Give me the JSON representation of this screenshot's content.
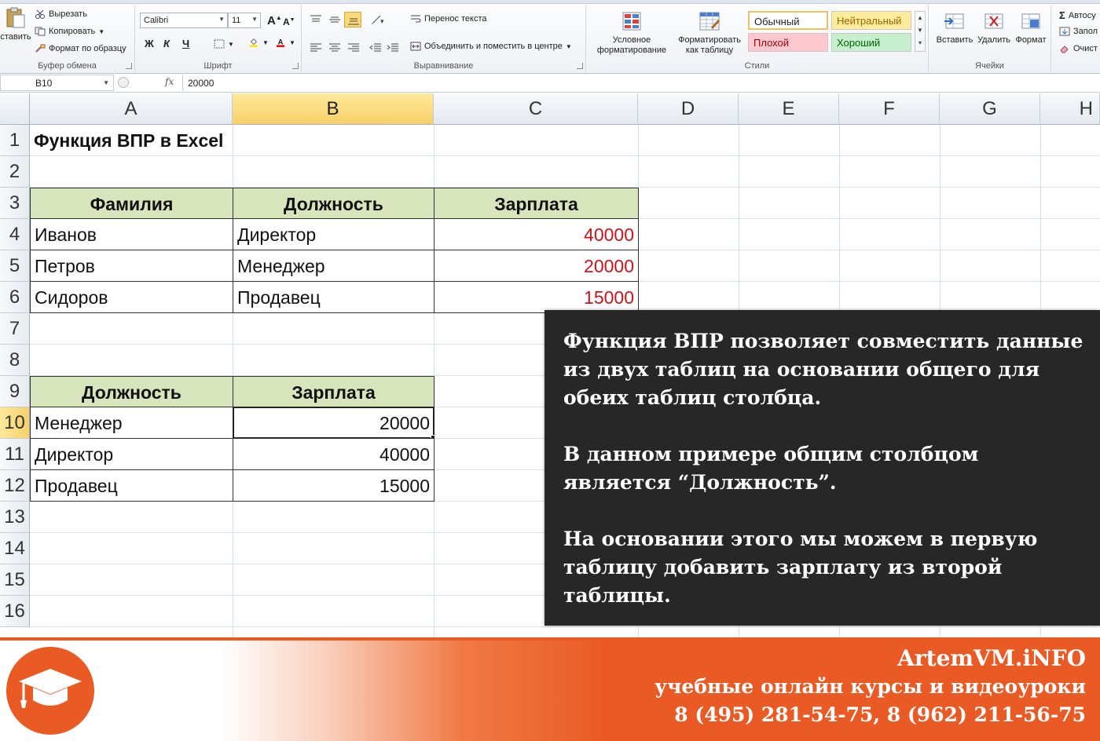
{
  "ribbon": {
    "clipboard": {
      "paste": "ставить",
      "cut": "Вырезать",
      "copy": "Копировать",
      "format_painter": "Формат по образцу",
      "label": "Буфер обмена"
    },
    "font": {
      "name": "Calibri",
      "size": "11",
      "grow": "A",
      "shrink": "A",
      "bold": "Ж",
      "italic": "К",
      "underline": "Ч",
      "label": "Шрифт"
    },
    "alignment": {
      "wrap": "Перенос текста",
      "merge": "Объединить и поместить в центре",
      "label": "Выравнивание"
    },
    "styles": {
      "conditional": "Условное форматирование",
      "as_table": "Форматировать как таблицу",
      "normal": "Обычный",
      "neutral": "Нейтральный",
      "bad": "Плохой",
      "good": "Хороший",
      "label": "Стили"
    },
    "cells": {
      "insert": "Вставить",
      "delete": "Удалить",
      "format": "Формат",
      "label": "Ячейки"
    },
    "editing": {
      "autosum": "Автосу",
      "fill": "Запол",
      "clear": "Очист"
    }
  },
  "formula_bar": {
    "name_box": "B10",
    "fx": "fx",
    "value": "20000"
  },
  "columns": [
    "A",
    "B",
    "C",
    "D",
    "E",
    "F",
    "G",
    "H"
  ],
  "rows": [
    "1",
    "2",
    "3",
    "4",
    "5",
    "6",
    "7",
    "8",
    "9",
    "10",
    "11",
    "12",
    "13",
    "14",
    "15",
    "16"
  ],
  "sheet": {
    "title": "Функция ВПР в Excel",
    "table1": {
      "headers": [
        "Фамилия",
        "Должность",
        "Зарплата"
      ],
      "rows": [
        [
          "Иванов",
          "Директор",
          "40000"
        ],
        [
          "Петров",
          "Менеджер",
          "20000"
        ],
        [
          "Сидоров",
          "Продавец",
          "15000"
        ]
      ]
    },
    "table2": {
      "headers": [
        "Должность",
        "Зарплата"
      ],
      "rows": [
        [
          "Менеджер",
          "20000"
        ],
        [
          "Директор",
          "40000"
        ],
        [
          "Продавец",
          "15000"
        ]
      ]
    }
  },
  "callout": {
    "p1": "Функция ВПР позволяет совместить данные из двух таблиц на основании общего для обеих таблиц столбца.",
    "p2": "В данном примере общим столбцом является “Должность”.",
    "p3": "На основании этого мы можем в первую таблицу добавить зарплату из второй таблицы."
  },
  "footer": {
    "brand": "ArtemVM.iNFO",
    "tagline": "учебные онлайн курсы и видеоуроки",
    "phones": "8 (495) 281-54-75, 8 (962) 211-56-75"
  },
  "colors": {
    "accent_orange": "#ea5a25",
    "header_green": "#d8e4bc",
    "value_red": "#d0121b",
    "callout_bg": "#272727"
  }
}
